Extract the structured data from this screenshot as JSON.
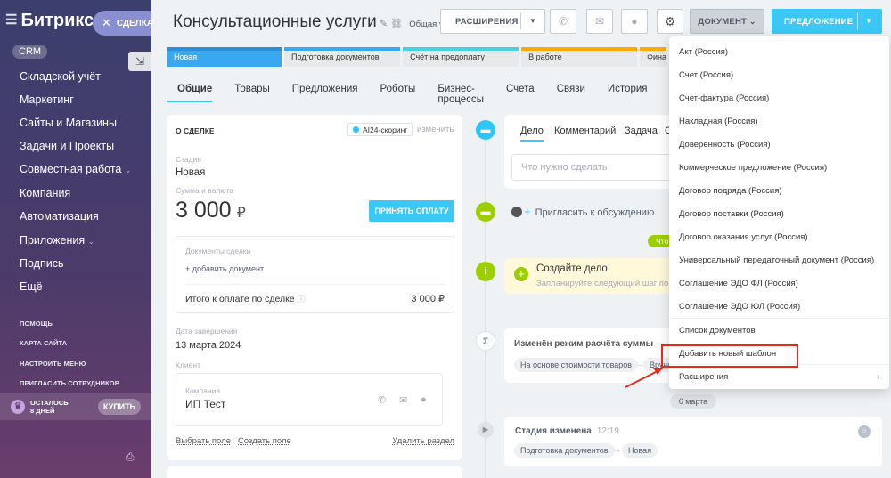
{
  "sidebar": {
    "logo_text": "Битрикс",
    "logo_num": "2",
    "deal_pill": "СДЕЛКА",
    "items": [
      {
        "label": "CRM"
      },
      {
        "label": "Складской учёт"
      },
      {
        "label": "Маркетинг"
      },
      {
        "label": "Сайты и Магазины"
      },
      {
        "label": "Задачи и Проекты"
      },
      {
        "label": "Совместная работа"
      },
      {
        "label": "Компания"
      },
      {
        "label": "Автоматизация"
      },
      {
        "label": "Приложения"
      },
      {
        "label": "Подпись"
      },
      {
        "label": "Ещё"
      }
    ],
    "sub_items": [
      {
        "label": "ПОМОЩЬ"
      },
      {
        "label": "КАРТА САЙТА"
      },
      {
        "label": "НАСТРОИТЬ МЕНЮ"
      },
      {
        "label": "ПРИГЛАСИТЬ СОТРУДНИКОВ"
      }
    ],
    "trial_line1": "ОСТАЛОСЬ",
    "trial_line2": "8 ДНЕЙ",
    "buy_label": "КУПИТЬ"
  },
  "header": {
    "title": "Консультационные услуги",
    "category": "Общая",
    "extensions_label": "РАСШИРЕНИЯ",
    "document_label": "ДОКУМЕНТ",
    "offer_label": "ПРЕДЛОЖЕНИЕ"
  },
  "stages": [
    {
      "label": "Новая"
    },
    {
      "label": "Подготовка документов"
    },
    {
      "label": "Счёт на предоплату"
    },
    {
      "label": "В работе"
    },
    {
      "label": "Фина"
    }
  ],
  "tabs": [
    {
      "label": "Общие"
    },
    {
      "label": "Товары"
    },
    {
      "label": "Предложения"
    },
    {
      "label": "Роботы"
    },
    {
      "label": "Бизнес-процессы"
    },
    {
      "label": "Счета"
    },
    {
      "label": "Связи"
    },
    {
      "label": "История"
    }
  ],
  "deal": {
    "section_title": "О СДЕЛКЕ",
    "ai_badge": "AI24-скоринг",
    "change_link": "изменить",
    "stage_label": "Стадия",
    "stage_value": "Новая",
    "sum_label": "Сумма и валюта",
    "sum_value": "3 000",
    "currency": "₽",
    "pay_button": "ПРИНЯТЬ ОПЛАТУ",
    "docs_label": "Документы сделки",
    "add_doc": "+ добавить документ",
    "to_pay_label": "Итого к оплате по сделке",
    "to_pay_value": "3 000 ₽",
    "close_date_label": "Дата завершения",
    "close_date_value": "13 марта 2024",
    "client_label": "Клиент",
    "company_label": "Компания",
    "company_value": "ИП Тест",
    "link_select_field": "Выбрать поле",
    "link_create_field": "Создать поле",
    "link_delete_section": "Удалить раздел"
  },
  "timeline": {
    "edit_tabs": [
      {
        "label": "Дело"
      },
      {
        "label": "Комментарий"
      },
      {
        "label": "Задача"
      },
      {
        "label": "С"
      }
    ],
    "task_placeholder": "Что нужно сделать",
    "invite_text": "Пригласить к обсуждению",
    "green_chip": "Что",
    "create_title": "Создайте дело",
    "create_sub": "Запланируйте следующий шаг по сделке",
    "mode_title": "Изменён режим расчёта суммы",
    "mode_from": "На основе стоимости товаров",
    "mode_to": "Вручную",
    "date_chip": "6 марта",
    "stage_changed_title": "Стадия изменена",
    "stage_changed_time": "12:19",
    "stage_from": "Подготовка документов",
    "stage_to": "Новая"
  },
  "document_menu": {
    "items": [
      {
        "label": "Акт (Россия)"
      },
      {
        "label": "Счет (Россия)"
      },
      {
        "label": "Счет-фактура (Россия)"
      },
      {
        "label": "Накладная (Россия)"
      },
      {
        "label": "Доверенность (Россия)"
      },
      {
        "label": "Коммерческое предложение (Россия)"
      },
      {
        "label": "Договор подряда (Россия)"
      },
      {
        "label": "Договор поставки (Россия)"
      },
      {
        "label": "Договор оказания услуг (Россия)"
      },
      {
        "label": "Универсальный передаточный документ (Россия)"
      },
      {
        "label": "Соглашение ЭДО ФЛ (Россия)"
      },
      {
        "label": "Соглашение ЭДО ЮЛ (Россия)"
      }
    ],
    "list_docs": "Список документов",
    "add_template": "Добавить новый шаблон",
    "extensions": "Расширения"
  }
}
